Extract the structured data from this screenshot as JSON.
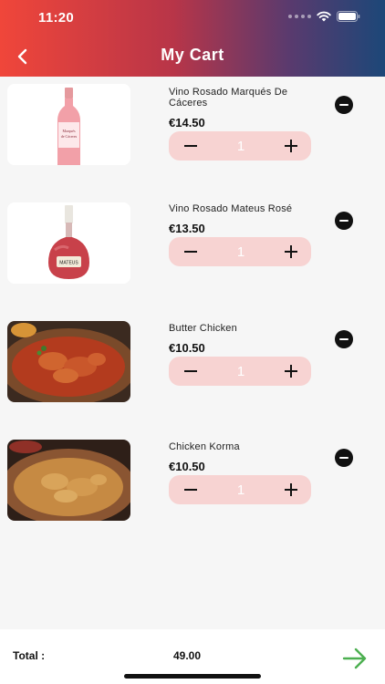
{
  "status_bar": {
    "time": "11:20"
  },
  "header": {
    "title": "My Cart"
  },
  "cart": {
    "items": [
      {
        "name": "Vino Rosado Marqués De Cáceres",
        "price": "€14.50",
        "quantity": "1",
        "image": "rose-wine-bottle",
        "label_lines": [
          "Marqués",
          "de Cáceres"
        ]
      },
      {
        "name": "Vino Rosado Mateus Rosé",
        "price": "€13.50",
        "quantity": "1",
        "image": "mateus-wine-bottle",
        "label_lines": [
          "MATEUS"
        ]
      },
      {
        "name": "Butter Chicken",
        "price": "€10.50",
        "quantity": "1",
        "image": "butter-chicken-dish"
      },
      {
        "name": "Chicken Korma",
        "price": "€10.50",
        "quantity": "1",
        "image": "chicken-korma-dish"
      }
    ]
  },
  "footer": {
    "total_label": "Total :",
    "total_value": "49.00"
  },
  "colors": {
    "stepper_bg": "#f7d3d2",
    "next_arrow": "#4caf50",
    "header_start": "#f0463a",
    "header_end": "#1c4778"
  }
}
